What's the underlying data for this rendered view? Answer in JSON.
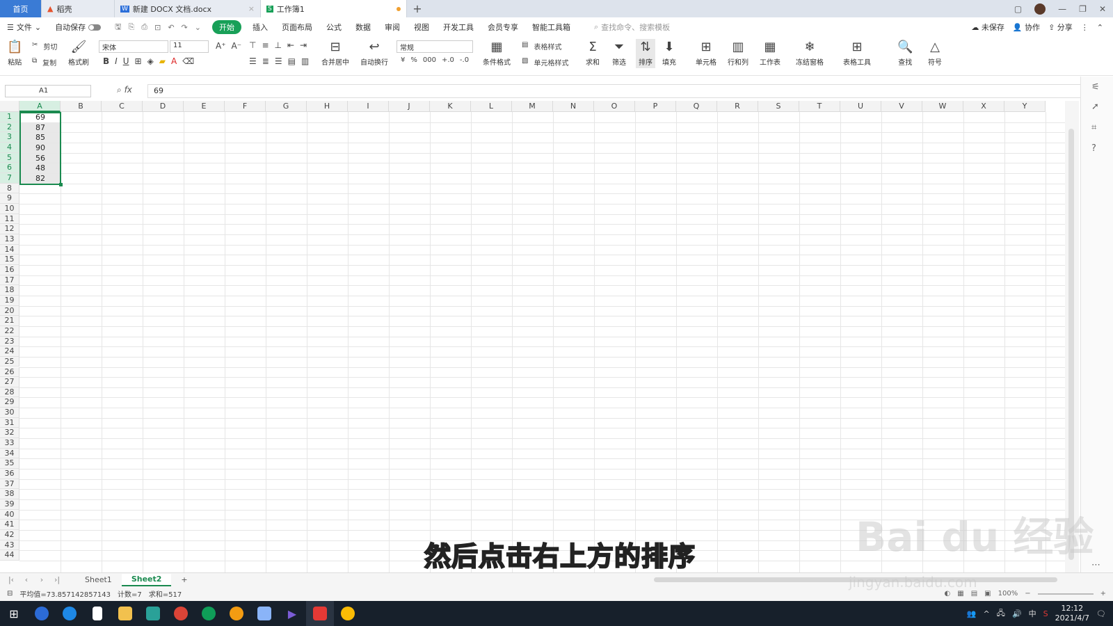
{
  "tabs": {
    "home": "首页",
    "t1": "稻壳",
    "t2": "新建 DOCX 文档.docx",
    "t3": "工作簿1",
    "new": "+"
  },
  "menu": {
    "file": "文件",
    "autosave": "自动保存",
    "items": [
      "开始",
      "插入",
      "页面布局",
      "公式",
      "数据",
      "审阅",
      "视图",
      "开发工具",
      "会员专享",
      "智能工具箱"
    ],
    "search": "查找命令、搜索模板",
    "unsaved": "未保存",
    "collab": "协作",
    "share": "分享"
  },
  "ribbon": {
    "paste": "粘贴",
    "cut": "剪切",
    "copy": "复制",
    "format_painter": "格式刷",
    "font": "宋体",
    "font_size": "11",
    "merge": "合并居中",
    "wrap": "自动换行",
    "number_format": "常规",
    "cond_format": "条件格式",
    "table_style": "表格样式",
    "cell_style": "单元格样式",
    "sum": "求和",
    "filter": "筛选",
    "sort": "排序",
    "fill": "填充",
    "cells": "单元格",
    "rowcol": "行和列",
    "sheet": "工作表",
    "freeze": "冻结窗格",
    "table_tool": "表格工具",
    "find": "查找",
    "symbol": "符号"
  },
  "formula": {
    "namebox": "A1",
    "fx": "fx",
    "value": "69"
  },
  "columns": [
    "A",
    "B",
    "C",
    "D",
    "E",
    "F",
    "G",
    "H",
    "I",
    "J",
    "K",
    "L",
    "M",
    "N",
    "O",
    "P",
    "Q",
    "R",
    "S",
    "T",
    "U",
    "V",
    "W",
    "X",
    "Y"
  ],
  "cells_A": [
    "69",
    "87",
    "85",
    "90",
    "56",
    "48",
    "82"
  ],
  "sheets": {
    "s1": "Sheet1",
    "s2": "Sheet2",
    "add": "+"
  },
  "status": {
    "avg": "平均值=73.857142857143",
    "count": "计数=7",
    "sum": "求和=517",
    "zoom": "100%"
  },
  "taskbar": {
    "time": "12:12",
    "date": "2021/4/7",
    "ime": "中"
  },
  "overlay": {
    "subtitle": "然后点击右上方的排序",
    "watermark": "Bai du 经验",
    "watermark_url": "jingyan.baidu.com"
  }
}
